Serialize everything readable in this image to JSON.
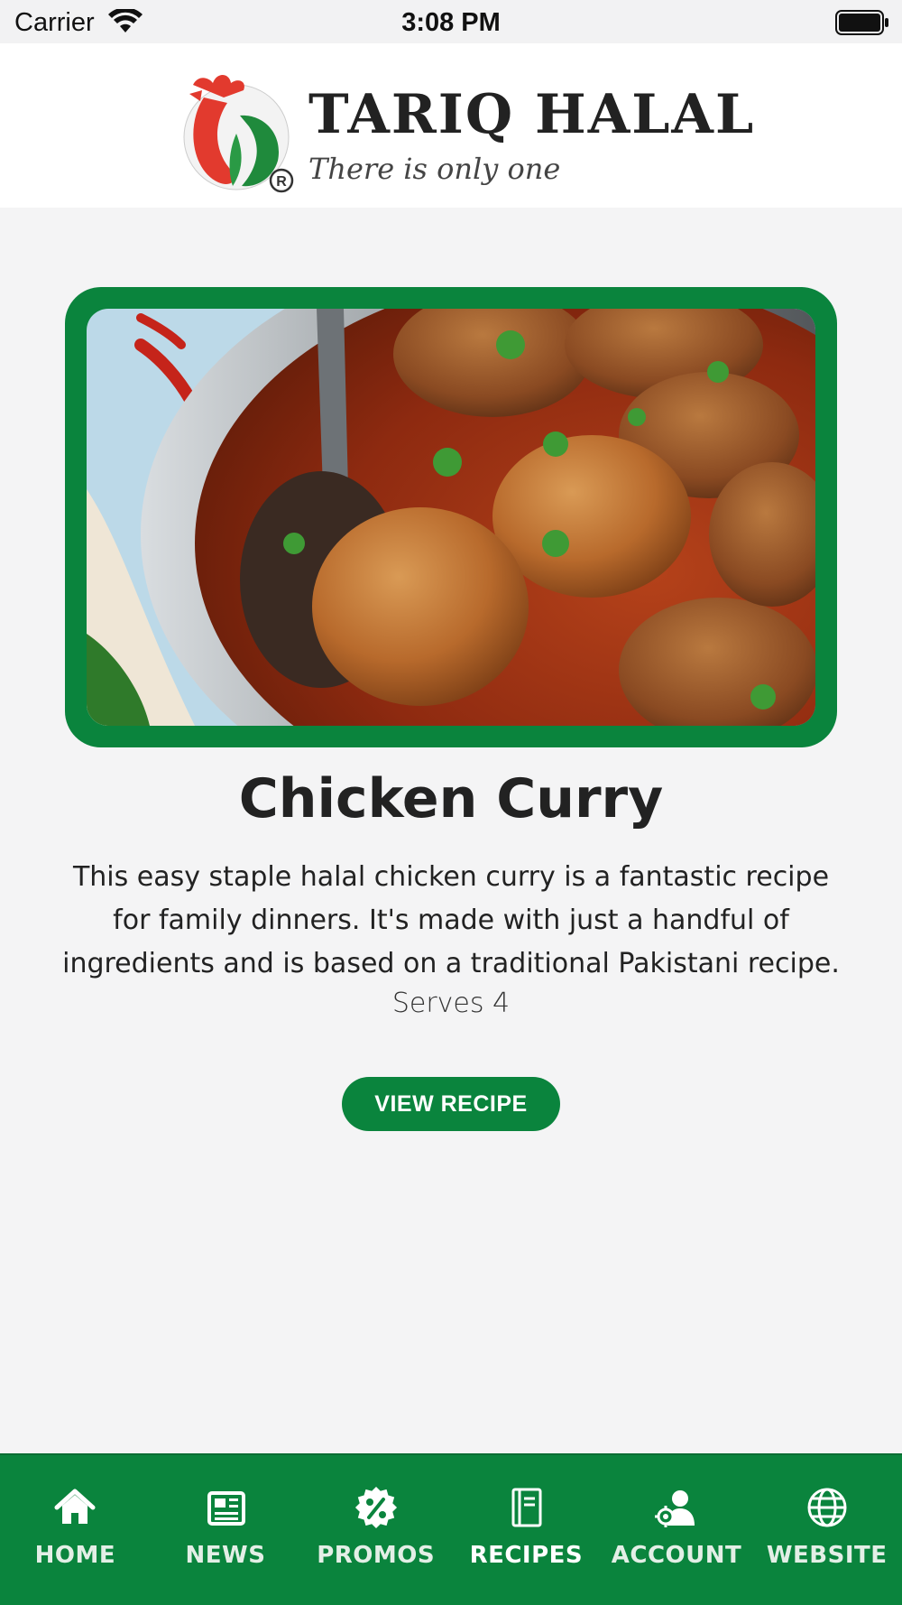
{
  "status_bar": {
    "carrier": "Carrier",
    "time": "3:08 PM",
    "wifi_icon": "wifi-icon",
    "battery_icon": "battery-icon"
  },
  "header": {
    "brand_name": "TARIQ HALAL",
    "tagline": "There is only one",
    "logo_icon": "rooster-logo-icon"
  },
  "recipe": {
    "title": "Chicken Curry",
    "description": "This easy staple halal chicken curry is a fantastic recipe for family dinners. It's made with just a handful of ingredients and is based on a traditional Pakistani recipe.",
    "serves": "Serves 4",
    "button_label": "VIEW RECIPE"
  },
  "tab_bar": {
    "items": [
      {
        "label": "HOME",
        "icon": "home-icon"
      },
      {
        "label": "NEWS",
        "icon": "newspaper-icon"
      },
      {
        "label": "PROMOS",
        "icon": "percent-badge-icon"
      },
      {
        "label": "RECIPES",
        "icon": "recipe-book-icon",
        "active": true
      },
      {
        "label": "ACCOUNT",
        "icon": "account-gear-icon"
      },
      {
        "label": "WEBSITE",
        "icon": "globe-icon"
      }
    ]
  },
  "colors": {
    "brand_green": "#0a843d",
    "logo_red": "#e23a2e",
    "background": "#f4f4f5"
  }
}
